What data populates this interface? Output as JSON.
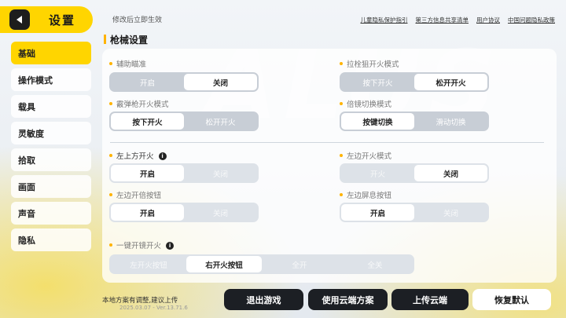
{
  "sidebar": {
    "title": "设置",
    "items": [
      {
        "label": "基础",
        "active": true
      },
      {
        "label": "操作模式"
      },
      {
        "label": "载具"
      },
      {
        "label": "灵敏度"
      },
      {
        "label": "拾取"
      },
      {
        "label": "画面"
      },
      {
        "label": "声音"
      },
      {
        "label": "隐私"
      }
    ]
  },
  "top": {
    "note": "修改后立即生效",
    "links": [
      "儿童隐私保护指引",
      "第三方信息共享清单",
      "用户协议",
      "中国问题隐私政策"
    ]
  },
  "section": {
    "title": "枪械设置"
  },
  "settings": {
    "aim_assist": {
      "label": "辅助瞄准",
      "options": [
        "开启",
        "关闭"
      ],
      "selected": "关闭"
    },
    "bolt_fire": {
      "label": "拉栓狙开火模式",
      "options": [
        "按下开火",
        "松开开火"
      ],
      "selected": "松开开火"
    },
    "shotgun_fire": {
      "label": "霰弹枪开火模式",
      "options": [
        "按下开火",
        "松开开火"
      ],
      "selected": "按下开火"
    },
    "scope_switch": {
      "label": "倍镜切换模式",
      "options": [
        "按键切换",
        "滑动切换"
      ],
      "selected": "按键切换"
    },
    "top_left_fire": {
      "label": "左上方开火",
      "options": [
        "开启",
        "关闭"
      ],
      "selected": "开启"
    },
    "left_fire_mode": {
      "label": "左边开火模式",
      "options": [
        "开火",
        "关闭"
      ],
      "selected": "关闭"
    },
    "left_lean": {
      "label": "左边开倍按钮",
      "options": [
        "开启",
        "关闭"
      ],
      "selected": "开启"
    },
    "left_screen": {
      "label": "左边屏息按钮",
      "options": [
        "开启",
        "关闭"
      ],
      "selected": "开启"
    },
    "one_key_scope": {
      "label": "一键开镜开火",
      "options": [
        "左开火按钮",
        "右开火按钮",
        "全开",
        "全关"
      ],
      "selected": "右开火按钮"
    }
  },
  "bottom": {
    "note": "本地方案有调整,建议上传",
    "version": "2025.03.07 - Ver.13.71.6",
    "buttons": [
      "退出游戏",
      "使用云端方案",
      "上传云端",
      "恢复默认"
    ]
  },
  "colors": {
    "accent": "#ffd500",
    "dark": "#1c1f24",
    "bullet": "#ffb300"
  }
}
